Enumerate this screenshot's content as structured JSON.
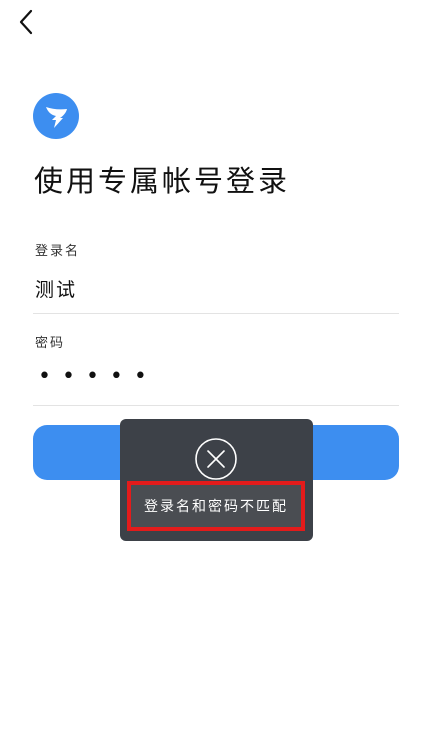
{
  "header": {
    "back_icon": "chevron-left-icon"
  },
  "logo": {
    "icon": "dingtalk-logo-icon",
    "color": "#3d8ef0"
  },
  "title": "使用专属帐号登录",
  "username": {
    "label": "登录名",
    "value": "测试"
  },
  "password": {
    "label": "密码",
    "masked_value": "•••••"
  },
  "login_button": {
    "color": "#3d8ef0"
  },
  "toast": {
    "icon": "close-circle-icon",
    "message": "登录名和密码不匹配",
    "highlight_color": "#e31b1b"
  }
}
